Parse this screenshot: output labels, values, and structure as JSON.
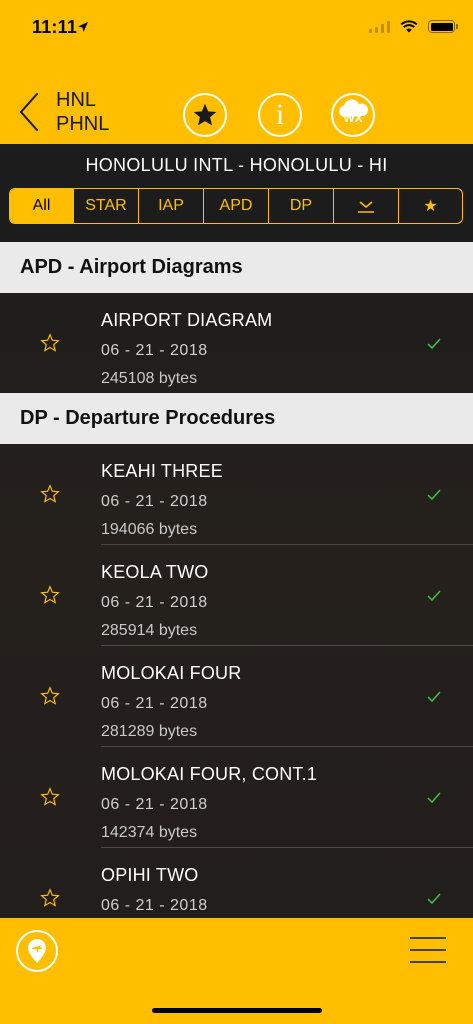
{
  "status": {
    "time": "11:11"
  },
  "header": {
    "ident_faa": "HNL",
    "ident_icao": "PHNL",
    "wx_label": "WX",
    "info_label": "i"
  },
  "airport": {
    "name": "HONOLULU INTL - HONOLULU - HI"
  },
  "filters": [
    {
      "label": "All",
      "active": true
    },
    {
      "label": "STAR"
    },
    {
      "label": "IAP"
    },
    {
      "label": "APD"
    },
    {
      "label": "DP"
    },
    {
      "label": "",
      "icon": "download-icon"
    },
    {
      "label": "★",
      "icon": "star-filled-icon"
    }
  ],
  "sections": [
    {
      "title": "APD - Airport Diagrams",
      "items": [
        {
          "title": "AIRPORT DIAGRAM",
          "date": "06 - 21 - 2018",
          "size": "245108 bytes"
        }
      ]
    },
    {
      "title": "DP - Departure Procedures",
      "items": [
        {
          "title": "KEAHI THREE",
          "date": "06 - 21 - 2018",
          "size": "194066 bytes"
        },
        {
          "title": "KEOLA TWO",
          "date": "06 - 21 - 2018",
          "size": "285914 bytes"
        },
        {
          "title": "MOLOKAI FOUR",
          "date": "06 - 21 - 2018",
          "size": "281289 bytes"
        },
        {
          "title": "MOLOKAI FOUR, CONT.1",
          "date": "06 - 21 - 2018",
          "size": "142374 bytes"
        },
        {
          "title": "OPIHI TWO",
          "date": "06 - 21 - 2018",
          "size": ""
        }
      ]
    }
  ],
  "colors": {
    "accent": "#ffbf00",
    "check": "#3dc43d",
    "section_bg": "#eaeaea"
  }
}
